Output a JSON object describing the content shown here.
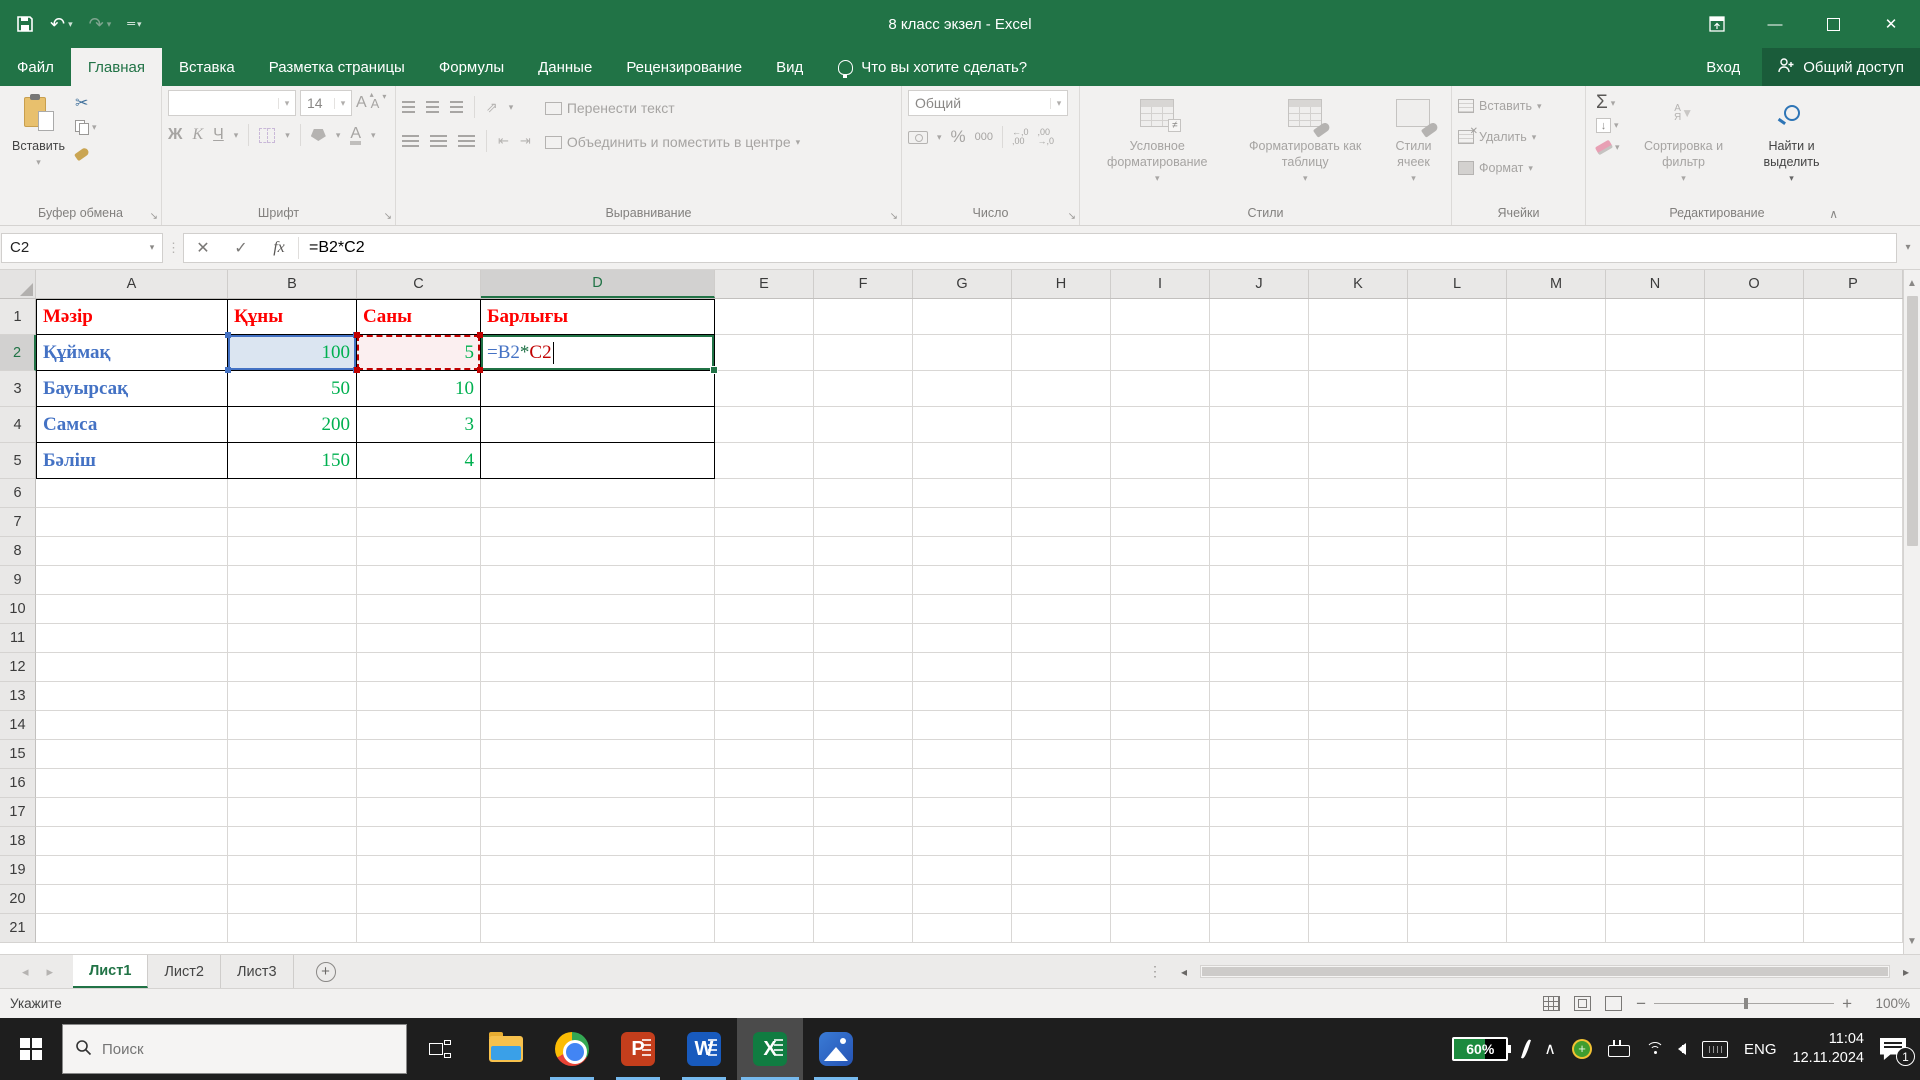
{
  "titlebar": {
    "title": "8 класс экзел - Excel"
  },
  "ribbon_tabs": {
    "file": "Файл",
    "items": [
      "Главная",
      "Вставка",
      "Разметка страницы",
      "Формулы",
      "Данные",
      "Рецензирование",
      "Вид"
    ],
    "active": "Главная",
    "tell_me": "Что вы хотите сделать?",
    "sign_in": "Вход",
    "share": "Общий доступ"
  },
  "ribbon": {
    "clipboard": {
      "label": "Буфер обмена",
      "paste": "Вставить"
    },
    "font": {
      "label": "Шрифт",
      "name": "",
      "size": "14",
      "bold": "Ж",
      "italic": "К",
      "underline": "Ч",
      "grow": "А",
      "shrink": "А",
      "color_letter": "А"
    },
    "alignment": {
      "label": "Выравнивание",
      "wrap": "Перенести текст",
      "merge": "Объединить и поместить в центре"
    },
    "number": {
      "label": "Число",
      "format": "Общий",
      "percent": "%",
      "thousands": "000",
      "inc_top": "←,0",
      "inc_bot": ",00",
      "dec_top": ",00",
      "dec_bot": "→,0"
    },
    "styles": {
      "label": "Стили",
      "conditional": "Условное форматирование",
      "format_table": "Форматировать как таблицу",
      "cell_styles": "Стили ячеек"
    },
    "cells": {
      "label": "Ячейки",
      "insert": "Вставить",
      "delete": "Удалить",
      "format": "Формат"
    },
    "editing": {
      "label": "Редактирование",
      "autosum": "Σ",
      "sort": "Сортировка и фильтр",
      "find": "Найти и выделить",
      "sort_top": "А",
      "sort_bot": "Я"
    }
  },
  "formula_bar": {
    "name_box": "C2",
    "fx": "fx",
    "formula": "=B2*C2",
    "parts": [
      {
        "text": "=B2",
        "color": "#4472C4"
      },
      {
        "text": "*",
        "color": "#1E7145"
      },
      {
        "text": "C2",
        "color": "#C00000"
      }
    ]
  },
  "sheet": {
    "columns": [
      "A",
      "B",
      "C",
      "D",
      "E",
      "F",
      "G",
      "H",
      "I",
      "J",
      "K",
      "L",
      "M",
      "N",
      "O",
      "P"
    ],
    "active_column": "D",
    "active_row": 2,
    "row_count": 21,
    "cells": {
      "A1": {
        "text": "Мәзір",
        "style": "hdr"
      },
      "B1": {
        "text": "Құны",
        "style": "hdr"
      },
      "C1": {
        "text": "Саны",
        "style": "hdr"
      },
      "D1": {
        "text": "Барлығы",
        "style": "hdr"
      },
      "A2": {
        "text": "Құймақ",
        "style": "item"
      },
      "B2": {
        "text": "100",
        "style": "num",
        "sel": "blue"
      },
      "C2": {
        "text": "5",
        "style": "num",
        "sel": "red"
      },
      "D2": {
        "formula": true,
        "sel": "active"
      },
      "A3": {
        "text": "Бауырсақ",
        "style": "item"
      },
      "B3": {
        "text": "50",
        "style": "num"
      },
      "C3": {
        "text": "10",
        "style": "num"
      },
      "A4": {
        "text": "Самса",
        "style": "item"
      },
      "B4": {
        "text": "200",
        "style": "num"
      },
      "C4": {
        "text": "3",
        "style": "num"
      },
      "A5": {
        "text": "Бәліш",
        "style": "item"
      },
      "B5": {
        "text": "150",
        "style": "num"
      },
      "C5": {
        "text": "4",
        "style": "num"
      }
    },
    "colors": {
      "header_text": "#FF0000",
      "item_text": "#4472C4",
      "number_text": "#00B050",
      "excel_green": "#217346",
      "ref_blue": "#4472C4",
      "ref_red": "#C00000"
    }
  },
  "sheet_tabs": {
    "items": [
      "Лист1",
      "Лист2",
      "Лист3"
    ],
    "active": "Лист1"
  },
  "status_bar": {
    "mode": "Укажите",
    "zoom": "100%"
  },
  "taskbar": {
    "search_placeholder": "Поиск",
    "apps": [
      "explorer",
      "chrome",
      "powerpoint",
      "word",
      "excel",
      "photos"
    ],
    "active_app": "excel",
    "battery": "60%",
    "language": "ENG",
    "time": "11:04",
    "date": "12.11.2024",
    "notification_count": "1"
  }
}
